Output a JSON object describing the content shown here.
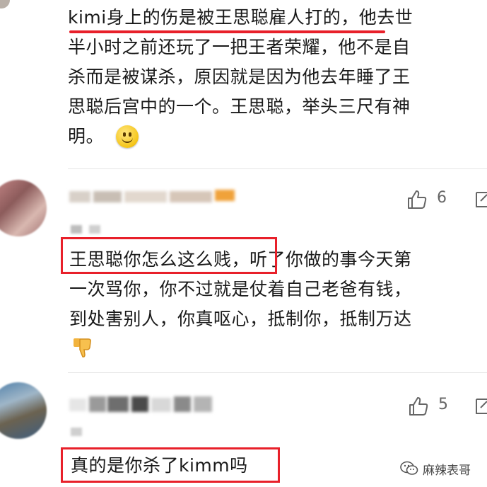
{
  "comment1": {
    "lines": [
      "kimi身上的伤是被王思聪雇人打的，他去世",
      "半小时之前还玩了一把王者荣耀，他不是自",
      "杀而是被谋杀，原因就是因为他去年睡了王",
      "思聪后宫中的一个。王思聪，举头三尺有神",
      "明。"
    ],
    "emoji": "smile-emoji"
  },
  "comment2": {
    "likes": "6",
    "lines": [
      "王思聪你怎么这么贱，听了你做的事今天第",
      "一次骂你，你不过就是仗着自己老爸有钱，",
      "到处害别人，你真呕心，抵制你，抵制万达"
    ],
    "emoji": "thumbs-down-emoji"
  },
  "comment3": {
    "likes": "5",
    "text": "真的是你杀了kimm吗"
  },
  "watermark": {
    "text": "麻辣表哥",
    "icon": "wechat-icon"
  },
  "colors": {
    "highlight_red": "#e8202a",
    "text": "#1a1a1a",
    "muted": "#666666"
  }
}
